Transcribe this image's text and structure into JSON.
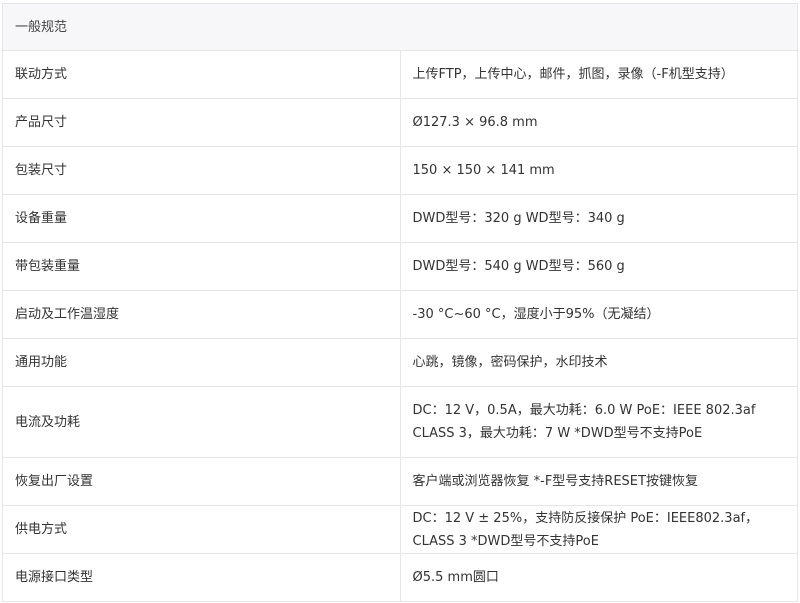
{
  "section": {
    "title": "一般规范"
  },
  "rows": [
    {
      "label": "联动方式",
      "value": "上传FTP，上传中心，邮件，抓图，录像（-F机型支持）"
    },
    {
      "label": "产品尺寸",
      "value": "Ø127.3 × 96.8 mm"
    },
    {
      "label": "包装尺寸",
      "value": "150 × 150 × 141 mm"
    },
    {
      "label": "设备重量",
      "value": "DWD型号：320 g WD型号：340 g"
    },
    {
      "label": "带包装重量",
      "value": "DWD型号：540 g WD型号：560 g"
    },
    {
      "label": "启动及工作温湿度",
      "value": "-30 °C~60 °C，湿度小于95%（无凝结）"
    },
    {
      "label": "通用功能",
      "value": "心跳，镜像，密码保护，水印技术"
    },
    {
      "label": "电流及功耗",
      "value": "DC：12 V，0.5A，最大功耗：6.0 W PoE：IEEE 802.3af CLASS 3，最大功耗：7 W *DWD型号不支持PoE"
    },
    {
      "label": "恢复出厂设置",
      "value": "客户端或浏览器恢复 *-F型号支持RESET按键恢复"
    },
    {
      "label": "供电方式",
      "value": "DC：12 V ± 25%，支持防反接保护 PoE：IEEE802.3af，CLASS 3 *DWD型号不支持PoE"
    },
    {
      "label": "电源接口类型",
      "value": "Ø5.5 mm圆口"
    }
  ]
}
